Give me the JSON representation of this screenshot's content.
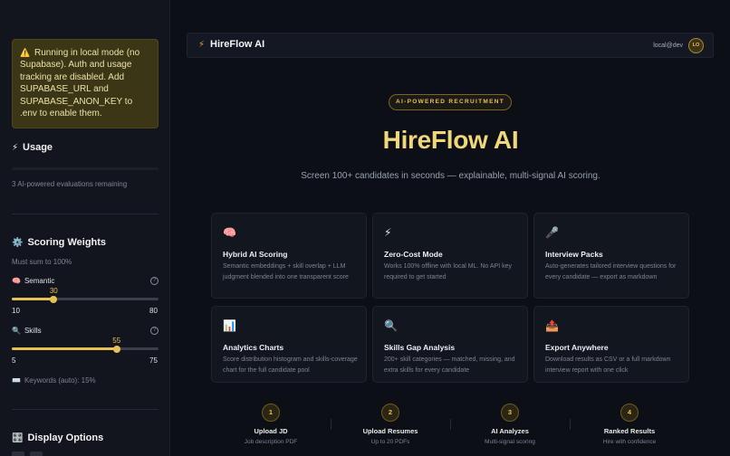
{
  "sidebar": {
    "warning": "Running in local mode (no Supabase). Auth and usage tracking are disabled. Add SUPABASE_URL and SUPABASE_ANON_KEY to .env to enable them.",
    "usage": {
      "title": "Usage",
      "remaining": "3 AI-powered evaluations remaining"
    },
    "weights": {
      "title": "Scoring Weights",
      "hint": "Must sum to 100%",
      "semantic": {
        "label": "Semantic",
        "value": "30",
        "min": "10",
        "max": "80",
        "fraction": 0.2857
      },
      "skills": {
        "label": "Skills",
        "value": "55",
        "min": "5",
        "max": "75",
        "fraction": 0.7143
      },
      "keywords": "Keywords (auto): 15%"
    },
    "display": {
      "title": "Display Options"
    }
  },
  "topbar": {
    "brand": "HireFlow AI",
    "user": "local@dev",
    "avatar": "LO"
  },
  "hero": {
    "badge": "AI-POWERED RECRUITMENT",
    "title": "HireFlow AI",
    "subtitle": "Screen 100+ candidates in seconds — explainable, multi-signal AI scoring."
  },
  "features": [
    {
      "icon": "🧠",
      "title": "Hybrid AI Scoring",
      "desc": "Semantic embeddings + skill overlap + LLM judgment blended into one transparent score"
    },
    {
      "icon": "⚡",
      "title": "Zero-Cost Mode",
      "desc": "Works 100% offline with local ML. No API key required to get started"
    },
    {
      "icon": "🎤",
      "title": "Interview Packs",
      "desc": "Auto-generates tailored interview questions for every candidate — export as markdown"
    },
    {
      "icon": "📊",
      "title": "Analytics Charts",
      "desc": "Score distribution histogram and skills-coverage chart for the full candidate pool"
    },
    {
      "icon": "🔍",
      "title": "Skills Gap Analysis",
      "desc": "200+ skill categories — matched, missing, and extra skills for every candidate"
    },
    {
      "icon": "📤",
      "title": "Export Anywhere",
      "desc": "Download results as CSV or a full markdown interview report with one click"
    }
  ],
  "steps": [
    {
      "num": "1",
      "title": "Upload JD",
      "sub": "Job description PDF"
    },
    {
      "num": "2",
      "title": "Upload Resumes",
      "sub": "Up to 20 PDFs"
    },
    {
      "num": "3",
      "title": "AI Analyzes",
      "sub": "Multi-signal scoring"
    },
    {
      "num": "4",
      "title": "Ranked Results",
      "sub": "Hire with confidence"
    }
  ],
  "colors": {
    "accent": "#e8c155",
    "bg": "#0c0f16",
    "sidebar": "#12151d",
    "warning_bg": "#3b3716"
  }
}
